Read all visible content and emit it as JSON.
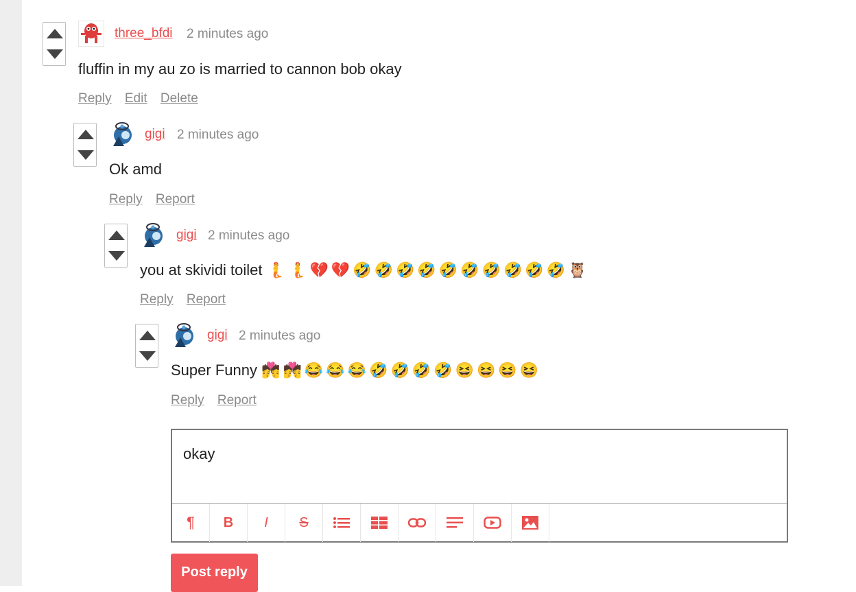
{
  "comments": [
    {
      "username": "three_bfdi",
      "time": "2 minutes ago",
      "text": "fluffin in my au zo is married to cannon bob okay",
      "emojis": "",
      "actions": [
        "Reply",
        "Edit",
        "Delete"
      ]
    },
    {
      "username": "gigi",
      "time": "2 minutes ago",
      "text": "Ok amd",
      "emojis": "",
      "actions": [
        "Reply",
        "Report"
      ]
    },
    {
      "username": "gigi",
      "time": "2 minutes ago",
      "text": "you at skividi toilet",
      "emojis": "🧜🧜💔💔🤣🤣🤣🤣🤣🤣🤣🤣🤣🤣🦉",
      "actions": [
        "Reply",
        "Report"
      ]
    },
    {
      "username": "gigi",
      "time": "2 minutes ago",
      "text": "Super Funny",
      "emojis": "💏💏😂😂😂🤣🤣🤣🤣😆😆😆😆",
      "actions": [
        "Reply",
        "Report"
      ]
    }
  ],
  "reply_box": {
    "value": "okay",
    "post_label": "Post reply",
    "toolbar_icons": [
      "paragraph-icon",
      "bold-icon",
      "italic-icon",
      "strikethrough-icon",
      "list-icon",
      "table-icon",
      "link-icon",
      "align-left-icon",
      "youtube-icon",
      "image-icon"
    ]
  },
  "colors": {
    "accent": "#e8504f",
    "button": "#f0555a",
    "muted": "#8a8a8a"
  }
}
